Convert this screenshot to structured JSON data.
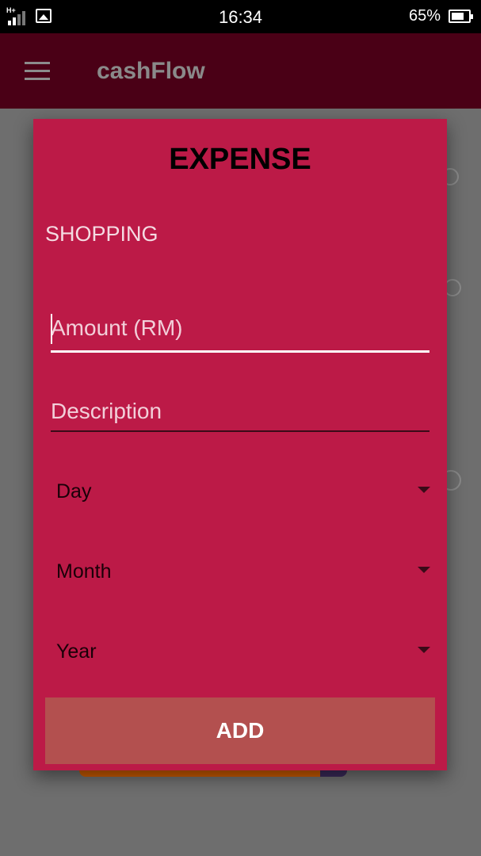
{
  "status_bar": {
    "network_type": "H+",
    "time": "16:34",
    "battery_percent": "65%",
    "icons": [
      "signal-icon",
      "image-notification-icon",
      "battery-icon"
    ]
  },
  "app_bar": {
    "title": "cashFlow",
    "menu_icon": "hamburger-menu-icon"
  },
  "dialog": {
    "heading": "EXPENSE",
    "category": "SHOPPING",
    "amount_field": {
      "placeholder": "Amount (RM)",
      "value": ""
    },
    "description_field": {
      "placeholder": "Description",
      "value": ""
    },
    "day_select": {
      "selected": "Day"
    },
    "month_select": {
      "selected": "Month"
    },
    "year_select": {
      "selected": "Year"
    },
    "add_button_label": "ADD"
  },
  "colors": {
    "status_bar": "#000000",
    "app_bar_dimmed": "#4a0016",
    "dialog_background": "#bc1a47",
    "add_button": "#b3504f",
    "overlay_background": "#6e6e6e"
  }
}
